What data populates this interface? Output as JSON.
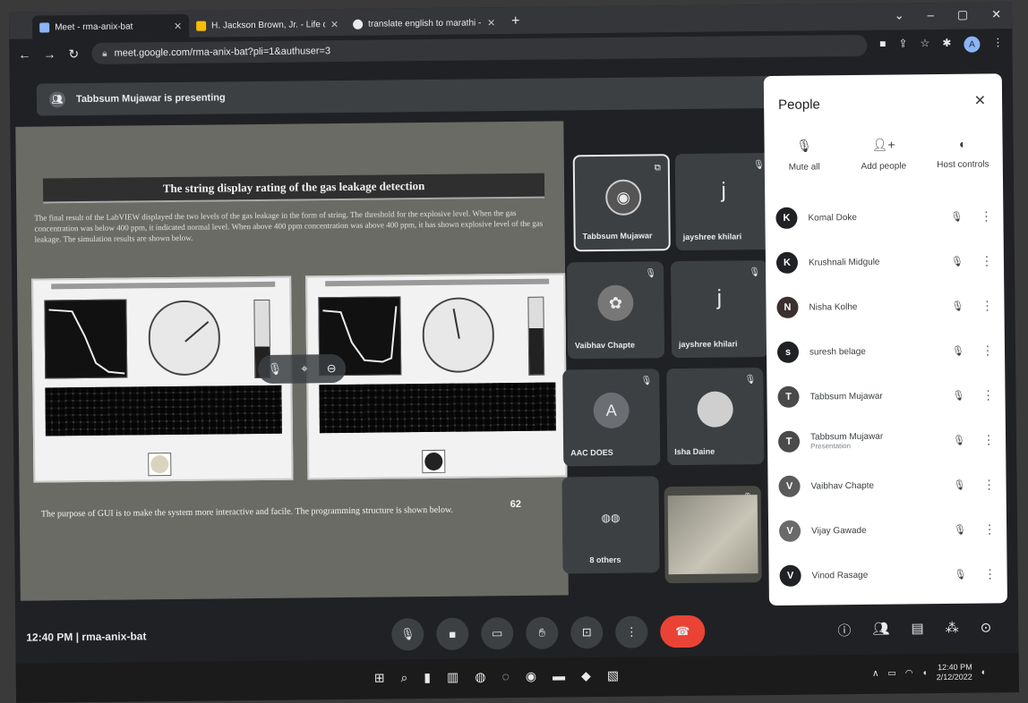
{
  "browser": {
    "tabs": [
      {
        "title": "Meet - rma-anix-bat",
        "active": true
      },
      {
        "title": "H. Jackson Brown, Jr. - Life doesn",
        "active": false
      },
      {
        "title": "translate english to marathi - Go",
        "active": false
      }
    ],
    "new_tab": "+",
    "url": "meet.google.com/rma-anix-bat?pli=1&authuser=3",
    "profile_initial": "A"
  },
  "presenting_banner": "Tabbsum Mujawar is presenting",
  "slide": {
    "title": "The string display rating of the gas leakage detection",
    "body": "The final result of the LabVIEW displayed the two levels of the gas leakage in the form of string. The threshold for the explosive level. When the gas concentration was below 400 ppm, it indicated normal level. When above 400 ppm concentration was above 400 ppm, it has shown explosive level of the gas leakage. The simulation results are shown below.",
    "footer": "The purpose of GUI is to make the system more interactive and facile. The programming structure is shown below.",
    "page_number": "62"
  },
  "tiles": [
    {
      "name": "Tabbsum Mujawar",
      "highlight": true
    },
    {
      "name": "jayshree khilari",
      "letter": "j"
    },
    {
      "name": "Vaibhav Chapte"
    },
    {
      "name": "jayshree khilari",
      "letter": "j"
    },
    {
      "name": "AAC DOES",
      "letter": "A"
    },
    {
      "name": "Isha Daine"
    },
    {
      "name": "8 others"
    }
  ],
  "people_panel": {
    "title": "People",
    "actions": {
      "mute_all": "Mute all",
      "add_people": "Add people",
      "host_controls": "Host controls"
    },
    "participants": [
      {
        "name": "Komal Doke",
        "initial": "K",
        "color": "#202124",
        "sub": ""
      },
      {
        "name": "Krushnali Midgule",
        "initial": "K",
        "color": "#202124",
        "sub": ""
      },
      {
        "name": "Nisha Kolhe",
        "initial": "N",
        "color": "#3c2f2f",
        "sub": ""
      },
      {
        "name": "suresh belage",
        "initial": "s",
        "color": "#202124",
        "sub": ""
      },
      {
        "name": "Tabbsum Mujawar",
        "initial": "T",
        "color": "#4a4a4a",
        "sub": ""
      },
      {
        "name": "Tabbsum Mujawar",
        "initial": "T",
        "color": "#4a4a4a",
        "sub": "Presentation"
      },
      {
        "name": "Vaibhav Chapte",
        "initial": "V",
        "color": "#5a5a5a",
        "sub": ""
      },
      {
        "name": "Vijay Gawade",
        "initial": "V",
        "color": "#6a6a6a",
        "sub": ""
      },
      {
        "name": "Vinod Rasage",
        "initial": "V",
        "color": "#202124",
        "sub": ""
      }
    ]
  },
  "meeting_bar": {
    "time": "12:40 PM",
    "separator": "|",
    "code": "rma-anix-bat"
  },
  "taskbar": {
    "time": "12:40 PM",
    "date": "2/12/2022"
  }
}
